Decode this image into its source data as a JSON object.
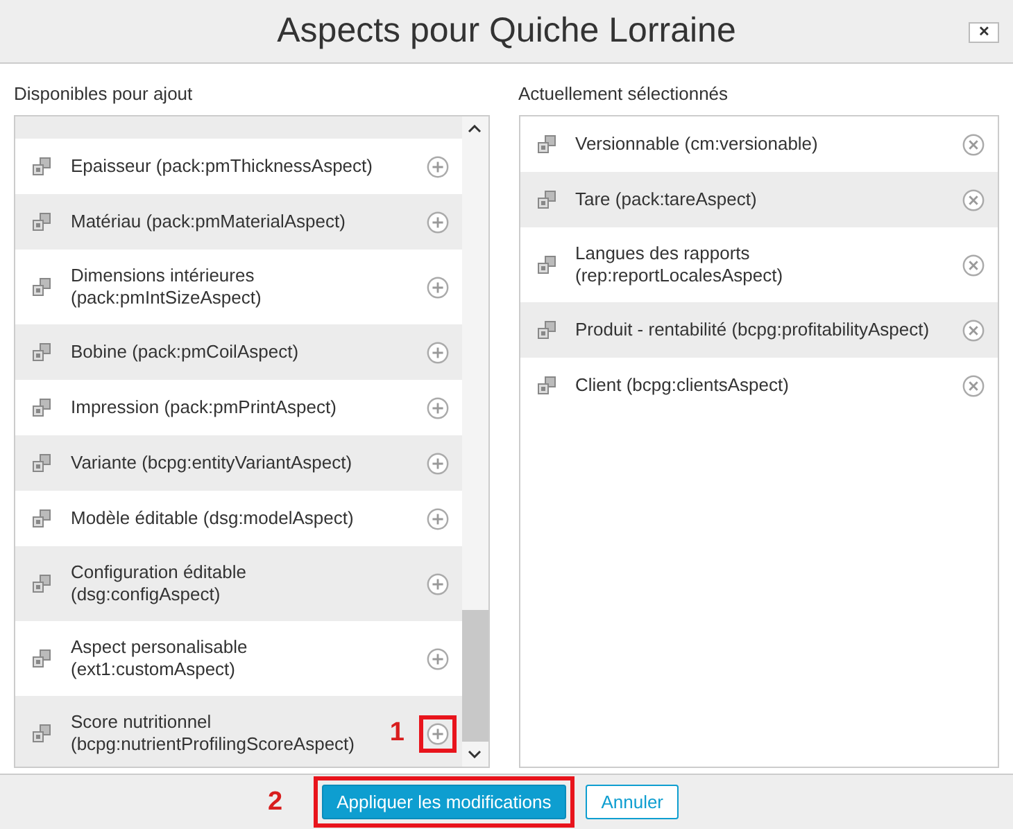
{
  "dialog": {
    "title": "Aspects pour Quiche Lorraine",
    "close_label": "✕"
  },
  "available": {
    "heading": "Disponibles pour ajout",
    "items": [
      {
        "lines": [
          "Epaisseur (pack:pmThicknessAspect)"
        ]
      },
      {
        "lines": [
          "Matériau (pack:pmMaterialAspect)"
        ]
      },
      {
        "lines": [
          "Dimensions intérieures",
          "(pack:pmIntSizeAspect)"
        ]
      },
      {
        "lines": [
          "Bobine (pack:pmCoilAspect)"
        ]
      },
      {
        "lines": [
          "Impression (pack:pmPrintAspect)"
        ]
      },
      {
        "lines": [
          "Variante (bcpg:entityVariantAspect)"
        ]
      },
      {
        "lines": [
          "Modèle éditable (dsg:modelAspect)"
        ]
      },
      {
        "lines": [
          "Configuration éditable",
          "(dsg:configAspect)"
        ]
      },
      {
        "lines": [
          "Aspect personalisable",
          "(ext1:customAspect)"
        ]
      },
      {
        "lines": [
          "Score nutritionnel",
          "(bcpg:nutrientProfilingScoreAspect)"
        ],
        "marker": "1"
      }
    ]
  },
  "selected": {
    "heading": "Actuellement sélectionnés",
    "items": [
      {
        "lines": [
          "Versionnable (cm:versionable)"
        ]
      },
      {
        "lines": [
          "Tare (pack:tareAspect)"
        ]
      },
      {
        "lines": [
          "Langues des rapports",
          "(rep:reportLocalesAspect)"
        ]
      },
      {
        "lines": [
          "Produit - rentabilité (bcpg:profitabilityAspect)"
        ]
      },
      {
        "lines": [
          "Client (bcpg:clientsAspect)"
        ]
      }
    ]
  },
  "buttons": [
    {
      "label": "Appliquer les modifications",
      "kind": "primary",
      "marker": "2"
    },
    {
      "label": "Annuler",
      "kind": "secondary"
    }
  ]
}
